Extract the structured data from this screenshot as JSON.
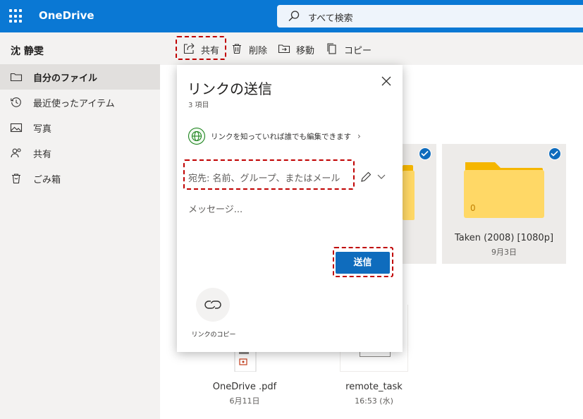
{
  "app": {
    "name": "OneDrive"
  },
  "search": {
    "placeholder": "すべて検索"
  },
  "user": {
    "name": "沈 静雯"
  },
  "sidebar": {
    "items": [
      {
        "label": "自分のファイル",
        "icon": "folder-icon",
        "active": true
      },
      {
        "label": "最近使ったアイテム",
        "icon": "history-icon",
        "active": false
      },
      {
        "label": "写真",
        "icon": "photo-icon",
        "active": false
      },
      {
        "label": "共有",
        "icon": "people-icon",
        "active": false
      },
      {
        "label": "ごみ箱",
        "icon": "trash-icon",
        "active": false
      }
    ]
  },
  "toolbar": {
    "share": "共有",
    "delete": "削除",
    "move": "移動",
    "copy": "コピー"
  },
  "tiles": [
    {
      "name": "",
      "date": "",
      "badge": "",
      "selected": true
    },
    {
      "name": "Taken (2008) [1080p]",
      "date": "9月3日",
      "badge": "0",
      "selected": true
    }
  ],
  "files": [
    {
      "name": "OneDrive .pdf",
      "date": "6月11日"
    },
    {
      "name": "remote_task",
      "date": "16:53 (水)"
    }
  ],
  "dialog": {
    "title": "リンクの送信",
    "subtitle": "3 項目",
    "permission": "リンクを知っていれば誰でも編集できます",
    "to_placeholder": "宛先: 名前、グループ、またはメール",
    "message_placeholder": "メッセージ...",
    "send": "送信",
    "copy_link": "リンクのコピー"
  },
  "colors": {
    "header": "#0a78d4",
    "accent": "#0f6cbd",
    "highlight": "#c00000",
    "folder": "#ffd866"
  }
}
